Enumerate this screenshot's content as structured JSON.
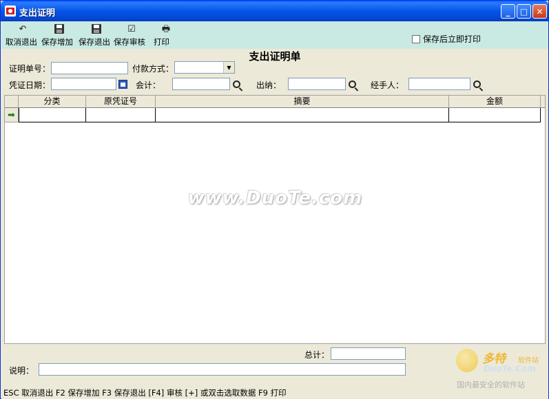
{
  "window": {
    "title": "支出证明"
  },
  "toolbar": {
    "cancel_exit": "取消退出",
    "save_add": "保存增加",
    "save_exit": "保存退出",
    "save_audit": "保存审核",
    "print": "打印",
    "print_after_save_label": "保存后立即打印",
    "print_after_save_checked": false
  },
  "form": {
    "title": "支出证明单",
    "voucher_no_label": "证明单号：",
    "voucher_no_value": "",
    "payment_method_label": "付款方式：",
    "payment_method_value": "",
    "voucher_date_label": "凭证日期：",
    "voucher_date_value": "",
    "accountant_label": "会计：",
    "accountant_value": "",
    "cashier_label": "出纳：",
    "cashier_value": "",
    "handler_label": "经手人：",
    "handler_value": ""
  },
  "grid": {
    "columns": [
      "分类",
      "原凭证号",
      "摘要",
      "金额"
    ],
    "rows": [
      [
        "",
        "",
        "",
        ""
      ]
    ]
  },
  "watermark": "www.DuoTe.com",
  "footer": {
    "total_label": "总计：",
    "total_value": "",
    "note_label": "说明：",
    "note_value": "",
    "shortcuts": "ESC 取消退出  F2 保存增加 F3 保存退出 [F4] 审核  [+] 或双击选取数据  F9 打印"
  },
  "logo": {
    "big_text": "多特",
    "small_text": "软件站",
    "url": "DuoTe.Com",
    "tagline": "国内最安全的软件站"
  }
}
